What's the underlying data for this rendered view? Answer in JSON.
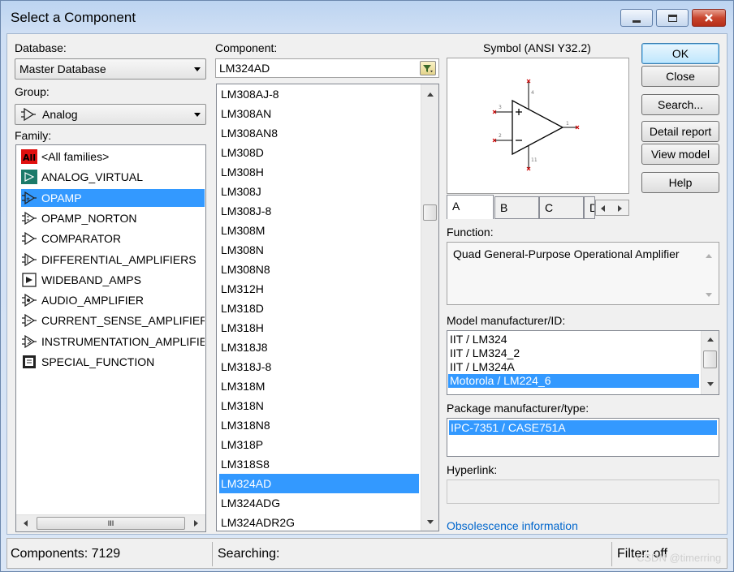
{
  "window": {
    "title": "Select a Component",
    "controls": [
      "minimize-icon",
      "maximize-icon",
      "close-icon"
    ]
  },
  "database": {
    "label": "Database:",
    "value": "Master Database"
  },
  "group": {
    "label": "Group:",
    "value": "Analog",
    "icon": "opamp-icon"
  },
  "family": {
    "label": "Family:",
    "items": [
      {
        "label": "<All families>",
        "icon": "all-families-icon"
      },
      {
        "label": "ANALOG_VIRTUAL",
        "icon": "virtual-icon"
      },
      {
        "label": "OPAMP",
        "icon": "opamp-icon",
        "selected": true
      },
      {
        "label": "OPAMP_NORTON",
        "icon": "opamp-norton-icon"
      },
      {
        "label": "COMPARATOR",
        "icon": "comparator-icon"
      },
      {
        "label": "DIFFERENTIAL_AMPLIFIERS",
        "icon": "differential-icon"
      },
      {
        "label": "WIDEBAND_AMPS",
        "icon": "wideband-icon"
      },
      {
        "label": "AUDIO_AMPLIFIER",
        "icon": "audio-icon"
      },
      {
        "label": "CURRENT_SENSE_AMPLIFIERS",
        "icon": "current-sense-icon"
      },
      {
        "label": "INSTRUMENTATION_AMPLIFIEI",
        "icon": "instrumentation-icon"
      },
      {
        "label": "SPECIAL_FUNCTION",
        "icon": "special-function-icon"
      }
    ],
    "hscroll_thumb": "III"
  },
  "component": {
    "label": "Component:",
    "value": "LM324AD",
    "items": [
      "LM308AJ-8",
      "LM308AN",
      "LM308AN8",
      "LM308D",
      "LM308H",
      "LM308J",
      "LM308J-8",
      "LM308M",
      "LM308N",
      "LM308N8",
      "LM312H",
      "LM318D",
      "LM318H",
      "LM318J8",
      "LM318J-8",
      "LM318M",
      "LM318N",
      "LM318N8",
      "LM318P",
      "LM318S8",
      "LM324AD",
      "LM324ADG",
      "LM324ADR2G"
    ],
    "selected": "LM324AD"
  },
  "symbol": {
    "label": "Symbol (ANSI Y32.2)",
    "tabs": [
      "A",
      "B",
      "C",
      "D"
    ],
    "active_tab": "A"
  },
  "function": {
    "label": "Function:",
    "value": "Quad General-Purpose Operational Amplifier"
  },
  "model": {
    "label": "Model manufacturer/ID:",
    "items": [
      "IIT / LM324",
      "IIT / LM324_2",
      "IIT / LM324A",
      "Motorola / LM224_6"
    ],
    "selected": "Motorola / LM224_6"
  },
  "package": {
    "label": "Package manufacturer/type:",
    "items": [
      "IPC-7351 / CASE751A"
    ],
    "selected": "IPC-7351 / CASE751A"
  },
  "hyperlink": {
    "label": "Hyperlink:",
    "value": ""
  },
  "obsolescence_link": "Obsolescence information",
  "buttons": {
    "ok": "OK",
    "close": "Close",
    "search": "Search...",
    "detail_report": "Detail report",
    "view_model": "View model",
    "help": "Help"
  },
  "status": {
    "components": "Components: 7129",
    "searching": "Searching:",
    "filter": "Filter: off"
  },
  "watermark": "CSDN @timerring",
  "colors": {
    "selection": "#3399ff",
    "link": "#0066cc",
    "symbol_pin": "#cc0000"
  }
}
